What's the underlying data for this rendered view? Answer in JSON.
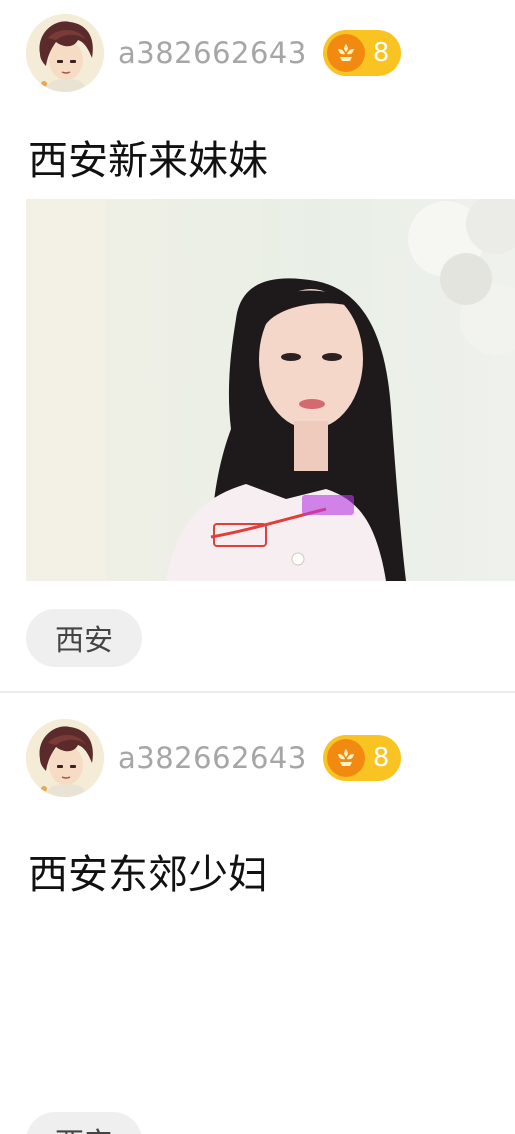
{
  "feed": {
    "posts": [
      {
        "username": "a382662643",
        "level": "8",
        "title": "西安新来妹妹",
        "image_description": "photo",
        "tag": "西安"
      },
      {
        "username": "a382662643",
        "level": "8",
        "title": "西安东郊少妇",
        "tag": "西安"
      }
    ]
  },
  "icons": {
    "level_icon": "flower-icon",
    "avatar": "anime-avatar"
  },
  "colors": {
    "badge_bg": "#f9c322",
    "badge_icon": "#f28a12",
    "username": "#a6a6a6",
    "tag_bg": "#efefef"
  }
}
